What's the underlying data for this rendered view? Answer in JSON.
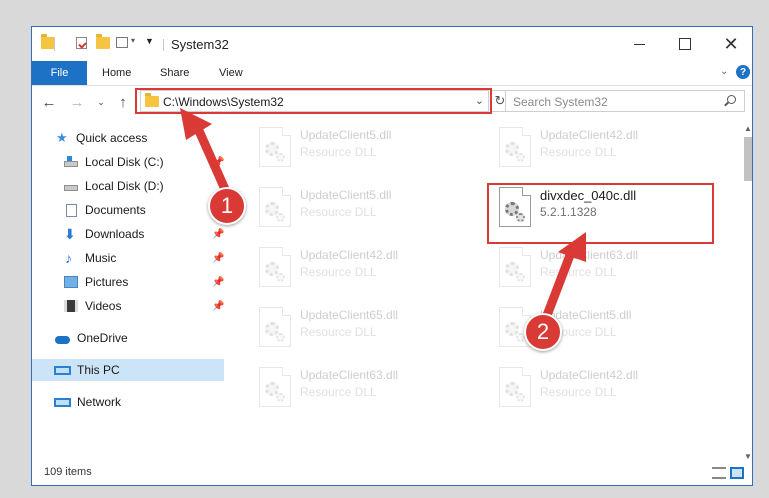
{
  "window": {
    "title": "System32",
    "colors": {
      "accent": "#1e72c6",
      "highlight": "#d93a36",
      "selection": "#cce4f7"
    }
  },
  "ribbon": {
    "tabs": [
      "File",
      "Home",
      "Share",
      "View"
    ],
    "collapse_glyph": "⌄",
    "help": "?"
  },
  "address": {
    "path": "C:\\Windows\\System32",
    "dropdown_glyph": "⌄",
    "refresh_glyph": "↻"
  },
  "search": {
    "placeholder": "Search System32"
  },
  "sidebar": {
    "items": [
      {
        "label": "Quick access",
        "icon": "star-icon"
      },
      {
        "label": "Local Disk (C:)",
        "icon": "drive-icon"
      },
      {
        "label": "Local Disk (D:)",
        "icon": "drive-icon"
      },
      {
        "label": "Documents",
        "icon": "documents-icon"
      },
      {
        "label": "Downloads",
        "icon": "downloads-icon"
      },
      {
        "label": "Music",
        "icon": "music-icon"
      },
      {
        "label": "Pictures",
        "icon": "pictures-icon"
      },
      {
        "label": "Videos",
        "icon": "videos-icon"
      },
      {
        "label": "OneDrive",
        "icon": "cloud-icon"
      },
      {
        "label": "This PC",
        "icon": "computer-icon"
      },
      {
        "label": "Network",
        "icon": "network-icon"
      }
    ],
    "pin_glyph": "📌"
  },
  "files": [
    {
      "name": "UpdateClient5.dll",
      "desc": "Resource DLL"
    },
    {
      "name": "UpdateClient42.dll",
      "desc": "Resource DLL"
    },
    {
      "name": "UpdateClient5.dll",
      "desc": "Resource DLL"
    },
    {
      "name": "divxdec_040c.dll",
      "desc": "5.2.1.1328"
    },
    {
      "name": "UpdateClient42.dll",
      "desc": "Resource DLL"
    },
    {
      "name": "UpdateClient63.dll",
      "desc": "Resource DLL"
    },
    {
      "name": "UpdateClient65.dll",
      "desc": "Resource DLL"
    },
    {
      "name": "UpdateClient5.dll",
      "desc": "Resource DLL"
    },
    {
      "name": "UpdateClient63.dll",
      "desc": "Resource DLL"
    },
    {
      "name": "UpdateClient42.dll",
      "desc": "Resource DLL"
    }
  ],
  "status": {
    "count": "109 items"
  },
  "callouts": [
    "1",
    "2"
  ]
}
